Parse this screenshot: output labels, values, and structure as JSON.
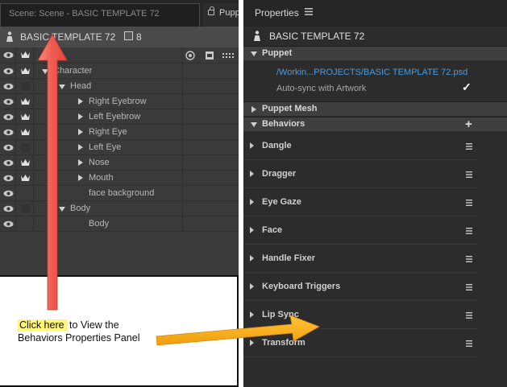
{
  "scene_tab": {
    "label": "Scene: Scene - BASIC TEMPLATE 72"
  },
  "puppet_tab": {
    "label": "Pupp"
  },
  "puppet_header": {
    "title": "BASIC TEMPLATE 72",
    "count": "8"
  },
  "tree": [
    {
      "label": "Character",
      "depth": 0,
      "toggle": "down",
      "crown": true
    },
    {
      "label": "Head",
      "depth": 1,
      "toggle": "down",
      "crown": false
    },
    {
      "label": "Right Eyebrow",
      "depth": 2,
      "toggle": "right",
      "crown": true
    },
    {
      "label": "Left Eyebrow",
      "depth": 2,
      "toggle": "right",
      "crown": true
    },
    {
      "label": "Right Eye",
      "depth": 2,
      "toggle": "right",
      "crown": true
    },
    {
      "label": "Left Eye",
      "depth": 2,
      "toggle": "right",
      "crown": false
    },
    {
      "label": "Nose",
      "depth": 2,
      "toggle": "right",
      "crown": true
    },
    {
      "label": "Mouth",
      "depth": 2,
      "toggle": "right",
      "crown": true
    },
    {
      "label": "face background",
      "depth": 2,
      "toggle": "none",
      "crown": false
    },
    {
      "label": "Body",
      "depth": 1,
      "toggle": "down",
      "crown": false
    },
    {
      "label": "Body",
      "depth": 2,
      "toggle": "none",
      "crown": false
    }
  ],
  "callout": {
    "highlight": "Click here",
    "rest_line1": " to View the",
    "line2": "Behaviors Properties Panel"
  },
  "properties": {
    "title": "Properties",
    "puppet_name": "BASIC TEMPLATE 72",
    "puppet_section": "Puppet",
    "puppet_path": "/Workin...PROJECTS/BASIC TEMPLATE 72.psd",
    "autosync_label": "Auto-sync with Artwork",
    "autosync_checked": true,
    "mesh_section": "Puppet Mesh",
    "behaviors_section": "Behaviors",
    "behaviors": [
      "Dangle",
      "Dragger",
      "Eye Gaze",
      "Face",
      "Handle Fixer",
      "Keyboard Triggers",
      "Lip Sync",
      "Transform"
    ]
  },
  "colors": {
    "arrow_red": "#f05a4f",
    "arrow_orange": "#f5a614",
    "link_blue": "#4a9be0",
    "highlight_yellow": "#fff67a"
  },
  "icons": {
    "eye": "eye-icon",
    "crown": "crown-icon",
    "puppet": "puppet-icon",
    "menu": "hamburger-icon",
    "plus": "plus-icon",
    "check": "checkmark-icon"
  }
}
